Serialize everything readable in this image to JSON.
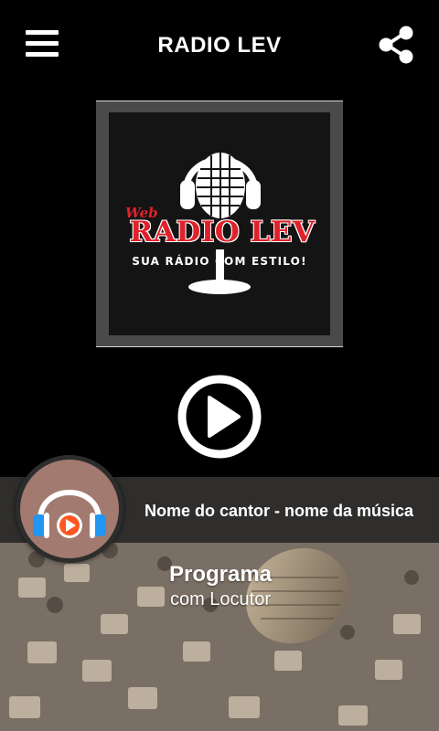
{
  "header": {
    "title": "RADIO LEV",
    "menu_icon": "hamburger-menu-icon",
    "share_icon": "share-icon"
  },
  "logo": {
    "web": "Web",
    "name": "RADIO LEV",
    "tagline": "SUA RÁDIO COM ESTILO!",
    "icon": "microphone-headphones-icon"
  },
  "player": {
    "play_icon": "play-icon",
    "now_playing": "Nome do cantor - nome da música",
    "avatar_icon": "headphones-play-icon"
  },
  "program": {
    "title": "Programa",
    "subtitle": "com Locutor"
  },
  "colors": {
    "background": "#000000",
    "brand_red": "#e0212b",
    "bar": "#282828",
    "avatar_bg": "#a27a70",
    "headphone_blue": "#2196f3",
    "play_orange": "#ff5722"
  }
}
